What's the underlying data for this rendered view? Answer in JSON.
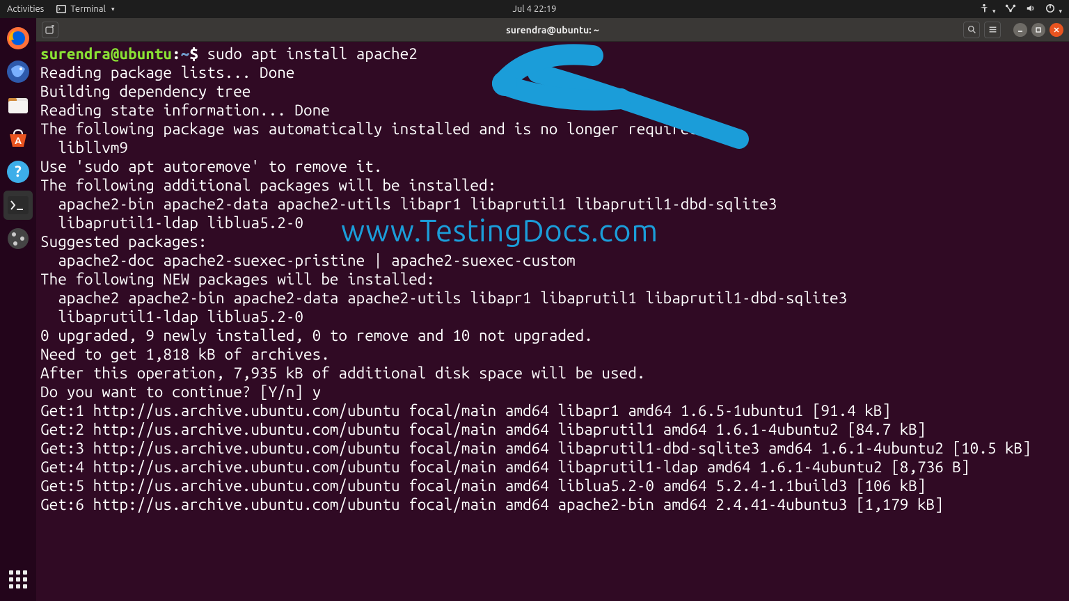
{
  "topbar": {
    "activities": "Activities",
    "app_menu": "Terminal",
    "clock": "Jul 4  22:19"
  },
  "dock": {
    "items": [
      {
        "name": "firefox"
      },
      {
        "name": "thunderbird"
      },
      {
        "name": "files"
      },
      {
        "name": "ubuntu-software"
      },
      {
        "name": "help"
      },
      {
        "name": "terminal"
      },
      {
        "name": "tweaks"
      }
    ]
  },
  "window": {
    "title": "surendra@ubuntu: ~",
    "newtab_tooltip": "New Tab"
  },
  "prompt": {
    "user": "surendra",
    "at": "@",
    "host": "ubuntu",
    "colon": ":",
    "path": "~",
    "dollar": "$ ",
    "command": "sudo apt install apache2"
  },
  "output_lines": [
    "Reading package lists... Done",
    "Building dependency tree",
    "Reading state information... Done",
    "The following package was automatically installed and is no longer required:",
    "  libllvm9",
    "Use 'sudo apt autoremove' to remove it.",
    "The following additional packages will be installed:",
    "  apache2-bin apache2-data apache2-utils libapr1 libaprutil1 libaprutil1-dbd-sqlite3",
    "  libaprutil1-ldap liblua5.2-0",
    "Suggested packages:",
    "  apache2-doc apache2-suexec-pristine | apache2-suexec-custom",
    "The following NEW packages will be installed:",
    "  apache2 apache2-bin apache2-data apache2-utils libapr1 libaprutil1 libaprutil1-dbd-sqlite3",
    "  libaprutil1-ldap liblua5.2-0",
    "0 upgraded, 9 newly installed, 0 to remove and 10 not upgraded.",
    "Need to get 1,818 kB of archives.",
    "After this operation, 7,935 kB of additional disk space will be used.",
    "Do you want to continue? [Y/n] y",
    "Get:1 http://us.archive.ubuntu.com/ubuntu focal/main amd64 libapr1 amd64 1.6.5-1ubuntu1 [91.4 kB]",
    "Get:2 http://us.archive.ubuntu.com/ubuntu focal/main amd64 libaprutil1 amd64 1.6.1-4ubuntu2 [84.7 kB]",
    "Get:3 http://us.archive.ubuntu.com/ubuntu focal/main amd64 libaprutil1-dbd-sqlite3 amd64 1.6.1-4ubuntu2 [10.5 kB]",
    "Get:4 http://us.archive.ubuntu.com/ubuntu focal/main amd64 libaprutil1-ldap amd64 1.6.1-4ubuntu2 [8,736 B]",
    "Get:5 http://us.archive.ubuntu.com/ubuntu focal/main amd64 liblua5.2-0 amd64 5.2.4-1.1build3 [106 kB]",
    "Get:6 http://us.archive.ubuntu.com/ubuntu focal/main amd64 apache2-bin amd64 2.4.41-4ubuntu3 [1,179 kB]"
  ],
  "watermark": "www.TestingDocs.com"
}
